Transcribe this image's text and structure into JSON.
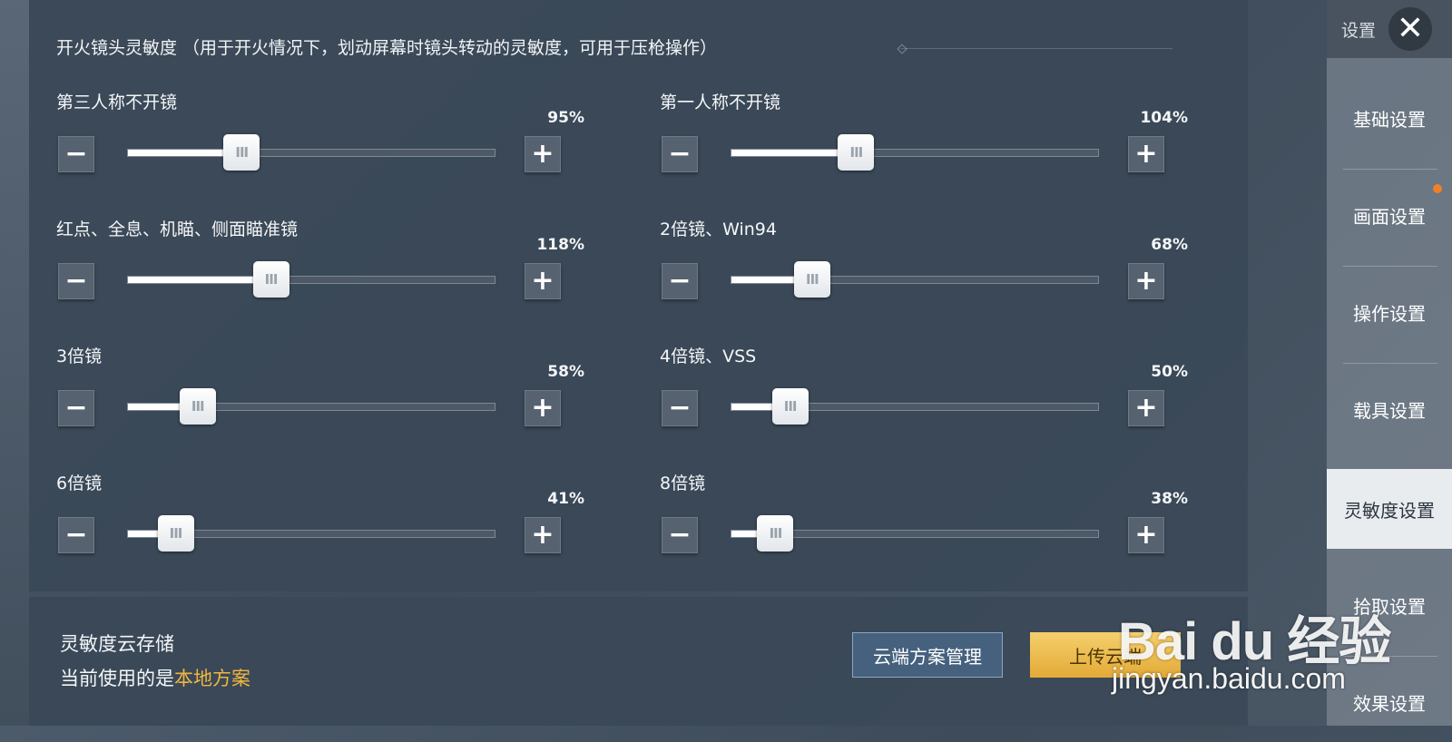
{
  "header": {
    "section_title": "开火镜头灵敏度 （用于开火情况下，划动屏幕时镜头转动的灵敏度，可用于压枪操作）"
  },
  "sliders": [
    {
      "label": "第三人称不开镜",
      "value_text": "95%",
      "value": 95,
      "position": 0.31
    },
    {
      "label": "第一人称不开镜",
      "value_text": "104%",
      "value": 104,
      "position": 0.34
    },
    {
      "label": "红点、全息、机瞄、侧面瞄准镜",
      "value_text": "118%",
      "value": 118,
      "position": 0.39
    },
    {
      "label": "2倍镜、Win94",
      "value_text": "68%",
      "value": 68,
      "position": 0.22
    },
    {
      "label": "3倍镜",
      "value_text": "58%",
      "value": 58,
      "position": 0.19
    },
    {
      "label": "4倍镜、VSS",
      "value_text": "50%",
      "value": 50,
      "position": 0.16
    },
    {
      "label": "6倍镜",
      "value_text": "41%",
      "value": 41,
      "position": 0.13
    },
    {
      "label": "8倍镜",
      "value_text": "38%",
      "value": 38,
      "position": 0.12
    }
  ],
  "controls": {
    "minus_glyph": "−",
    "plus_glyph": "+",
    "grip_glyph": "III"
  },
  "cloud": {
    "title": "灵敏度云存储",
    "status_prefix": "当前使用的是",
    "status_value": "本地方案",
    "manage_button": "云端方案管理",
    "upload_button": "上传云端"
  },
  "sidebar": {
    "title": "设置",
    "close_glyph": "✕",
    "items": [
      {
        "label": "基础设置",
        "active": false
      },
      {
        "label": "画面设置",
        "active": false,
        "notification": true
      },
      {
        "label": "操作设置",
        "active": false
      },
      {
        "label": "载具设置",
        "active": false
      },
      {
        "label": "灵敏度设置",
        "active": true
      },
      {
        "label": "拾取设置",
        "active": false
      },
      {
        "label": "效果设置",
        "active": false
      }
    ]
  },
  "watermark": {
    "brand": "Bai du 经验",
    "url": "jingyan.baidu.com"
  },
  "colors": {
    "accent": "#f0b640",
    "active_nav_bg": "#e9ecef",
    "notification": "#f08028"
  }
}
